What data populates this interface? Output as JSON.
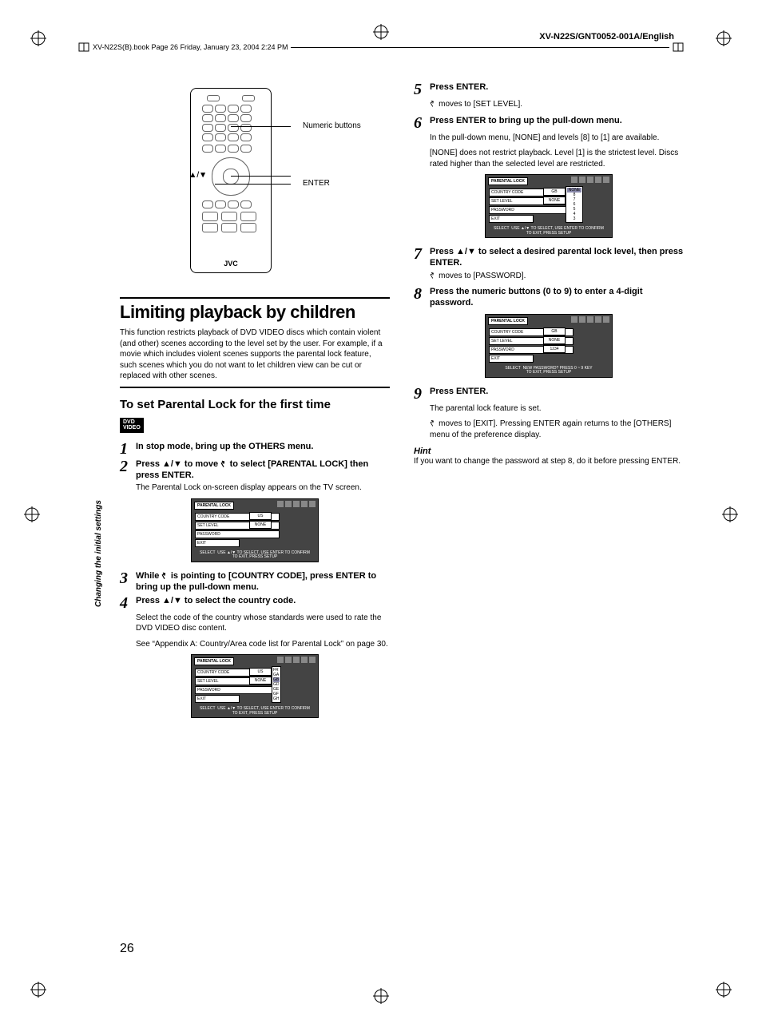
{
  "meta": {
    "doc_id": "XV-N22S/GNT0052-001A/English",
    "header_stamp": "XV-N22S(B).book  Page 26  Friday, January 23, 2004  2:24 PM",
    "page_number": "26",
    "side_label": "Changing the initial settings"
  },
  "remote": {
    "label_numeric": "Numeric buttons",
    "label_updown": "▲/▼",
    "label_enter": "ENTER",
    "brand": "JVC"
  },
  "section": {
    "title": "Limiting playback by children",
    "intro": "This function restricts playback of DVD VIDEO discs which contain violent (and other) scenes according to the level set by the user. For example, if a movie which includes violent scenes supports the parental lock feature, such scenes which you do not want to let children view can be cut or replaced with other scenes.",
    "sub1_title": "To set Parental Lock for the first time",
    "dvd_badge": "DVD VIDEO"
  },
  "steps": {
    "s1": {
      "title": "In stop mode, bring up the OTHERS menu."
    },
    "s2": {
      "title_a": "Press ▲/▼ to move ",
      "title_b": " to select [PARENTAL LOCK] then press ENTER.",
      "body": "The Parental Lock on-screen display appears on the TV screen."
    },
    "s3": {
      "title_a": "While ",
      "title_b": " is pointing to [COUNTRY CODE], press ENTER to bring up the pull-down menu."
    },
    "s4": {
      "title": "Press ▲/▼ to select the country code.",
      "body1": "Select the code of the country whose standards were used to rate the DVD VIDEO disc content.",
      "body2": "See “Appendix A: Country/Area code list for Parental Lock” on page 30."
    },
    "s5": {
      "title": "Press ENTER.",
      "body": " moves to [SET LEVEL]."
    },
    "s6": {
      "title": "Press ENTER to bring up the pull-down menu.",
      "body1": "In the pull-down menu, [NONE] and levels [8] to [1] are available.",
      "body2": "[NONE] does not restrict playback. Level [1] is the strictest level. Discs rated higher than the selected level are restricted."
    },
    "s7": {
      "title": "Press ▲/▼ to select a desired parental lock level, then press ENTER.",
      "body": " moves to [PASSWORD]."
    },
    "s8": {
      "title": "Press the numeric buttons (0 to 9) to enter a 4-digit password."
    },
    "s9": {
      "title": "Press ENTER.",
      "body1": "The parental lock feature is set.",
      "body2": " moves to [EXIT]. Pressing ENTER again returns to the [OTHERS] menu of the preference display."
    }
  },
  "osd": {
    "panel_title": "PARENTAL LOCK",
    "row_country": "COUNTRY CODE",
    "row_level": "SET LEVEL",
    "row_password": "PASSWORD",
    "row_exit": "EXIT",
    "val_us": "US",
    "val_none": "NONE",
    "val_gb": "GB",
    "val_pw": "1234",
    "foot_select": "SELECT",
    "foot_nav1": "USE ▲/▼ TO SELECT, USE ENTER TO CONFIRM",
    "foot_nav2": "TO EXIT, PRESS SETUP",
    "foot_pw": "NEW PASSWORD?    PRESS 0 ~ 9 KEY",
    "codes": [
      "FR",
      "GA",
      "GB",
      "GD",
      "GE",
      "GF",
      "GH"
    ],
    "levels": [
      "NONE",
      "8",
      "7",
      "6",
      "5",
      "4",
      "3"
    ]
  },
  "hint": {
    "head": "Hint",
    "body": "If you want to change the password at step 8, do it before pressing ENTER."
  }
}
